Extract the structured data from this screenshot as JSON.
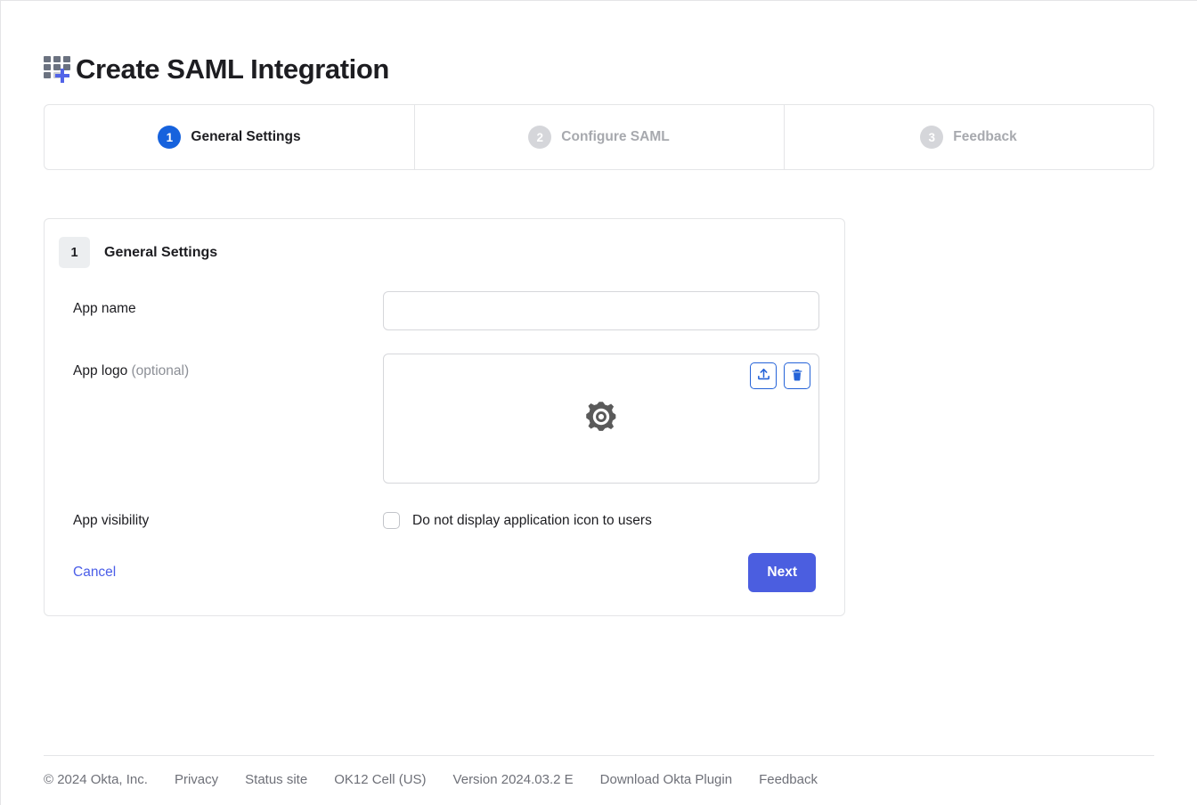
{
  "header": {
    "title": "Create SAML Integration",
    "icon": "app-grid-plus-icon"
  },
  "stepper": {
    "steps": [
      {
        "number": "1",
        "label": "General Settings",
        "state": "active"
      },
      {
        "number": "2",
        "label": "Configure SAML",
        "state": "inactive"
      },
      {
        "number": "3",
        "label": "Feedback",
        "state": "inactive"
      }
    ]
  },
  "card": {
    "section_number": "1",
    "section_title": "General Settings",
    "fields": {
      "app_name": {
        "label": "App name",
        "value": "",
        "placeholder": ""
      },
      "app_logo": {
        "label": "App logo",
        "optional_text": "(optional)",
        "upload_icon": "upload-icon",
        "delete_icon": "trash-icon",
        "placeholder_icon": "gear-icon"
      },
      "app_visibility": {
        "label": "App visibility",
        "checkbox_label": "Do not display application icon to users",
        "checked": false
      }
    },
    "actions": {
      "cancel_label": "Cancel",
      "next_label": "Next"
    }
  },
  "footer": {
    "copyright": "© 2024 Okta, Inc.",
    "links": [
      "Privacy",
      "Status site",
      "OK12 Cell (US)",
      "Version 2024.03.2 E",
      "Download Okta Plugin",
      "Feedback"
    ]
  },
  "colors": {
    "active_step": "#1662dd",
    "inactive_step": "#d5d6da",
    "primary_button": "#4b5ee0",
    "link": "#4a5de8",
    "icon_button_border": "#2563d8",
    "border": "#e4e5e7"
  }
}
